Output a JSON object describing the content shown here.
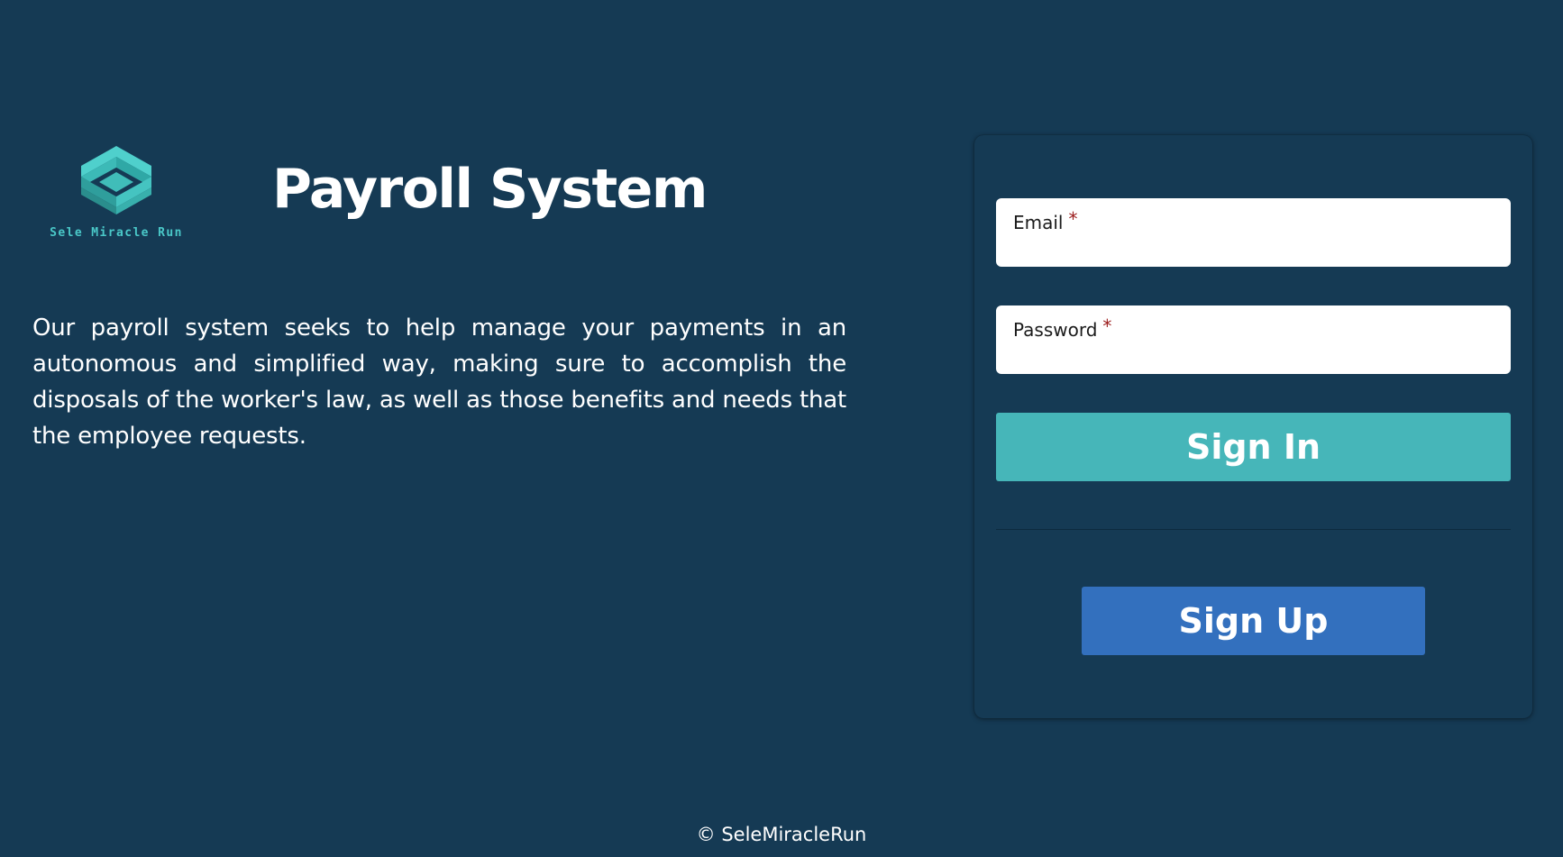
{
  "brand": {
    "logo_icon": "intertwined-cube-logo-icon",
    "logo_text": "Sele Miracle Run",
    "logo_color": "#4ac8c8"
  },
  "header": {
    "title": "Payroll System"
  },
  "intro": {
    "description": "Our payroll system seeks to help manage your payments in an autonomous and simplified way, making sure to accomplish the disposals of the worker's law, as well as those benefits and needs that the employee requests."
  },
  "login_form": {
    "email": {
      "label": "Email",
      "required_mark": "*",
      "value": ""
    },
    "password": {
      "label": "Password",
      "required_mark": "*",
      "value": ""
    },
    "sign_in_label": "Sign In",
    "sign_up_label": "Sign Up"
  },
  "footer": {
    "copyright": "© SeleMiracleRun"
  },
  "colors": {
    "background": "#153a54",
    "sign_in_button": "#46b6b9",
    "sign_up_button": "#3370be",
    "required_mark": "#9b1b1b"
  }
}
